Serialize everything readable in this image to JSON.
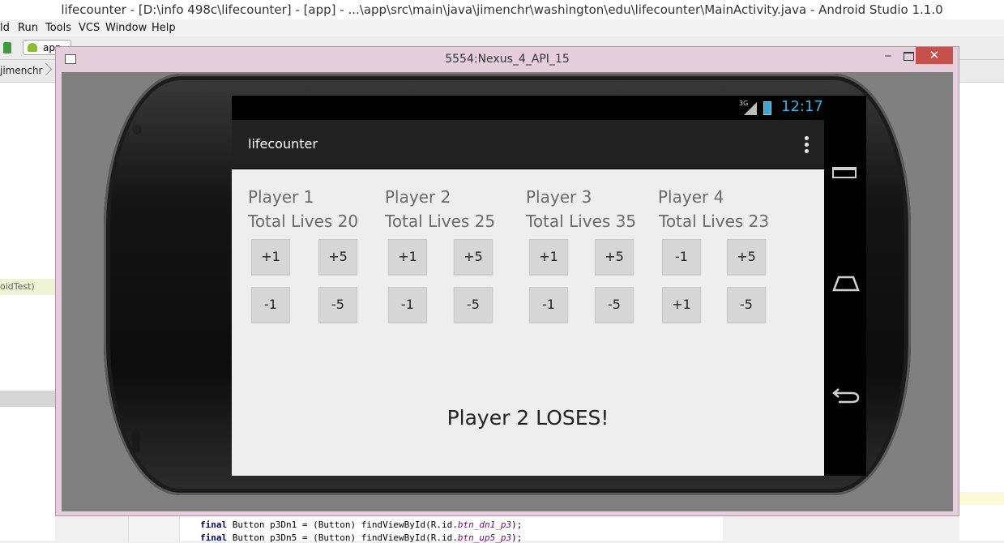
{
  "ide": {
    "title": "lifecounter - [D:\\info 498c\\lifecounter] - [app] - ...\\app\\src\\main\\java\\jimenchr\\washington\\edu\\lifecounter\\MainActivity.java - Android Studio 1.1.0",
    "menu": [
      "ld",
      "Run",
      "Tools",
      "VCS",
      "Window",
      "Help"
    ],
    "run_config": "app",
    "breadcrumb": "jimenchr",
    "left_panel_item": "oidTest)",
    "code_lines": [
      {
        "keyword": "final",
        "text": " Button p3Dn1  = (Button) findViewById(R.id.",
        "field": "btn_dn1_p3",
        "end": ");"
      },
      {
        "keyword": "final",
        "text": " Button p3Dn5  = (Button) findViewById(R.id.",
        "field": "btn_up5_p3",
        "end": ");"
      }
    ]
  },
  "emulator": {
    "window_title": "5554:Nexus_4_API_15",
    "status": {
      "network": "3G",
      "time": "12:17"
    },
    "app": {
      "title": "lifecounter",
      "players": [
        {
          "name": "Player 1",
          "lives": "Total Lives 20",
          "buttons": [
            "+1",
            "+5",
            "-1",
            "-5"
          ]
        },
        {
          "name": "Player 2",
          "lives": "Total Lives 25",
          "buttons": [
            "+1",
            "+5",
            "-1",
            "-5"
          ]
        },
        {
          "name": "Player 3",
          "lives": "Total Lives 35",
          "buttons": [
            "+1",
            "+5",
            "-1",
            "-5"
          ]
        },
        {
          "name": "Player 4",
          "lives": "Total Lives 23",
          "buttons": [
            "-1",
            "+5",
            "+1",
            "-5"
          ]
        }
      ],
      "result": "Player 2 LOSES!"
    }
  },
  "colors": {
    "emulator_frame": "#e6cfdd",
    "close_button": "#c7504b",
    "clock": "#33b5e5",
    "action_bar": "#212121",
    "content_bg": "#eeeeee"
  }
}
